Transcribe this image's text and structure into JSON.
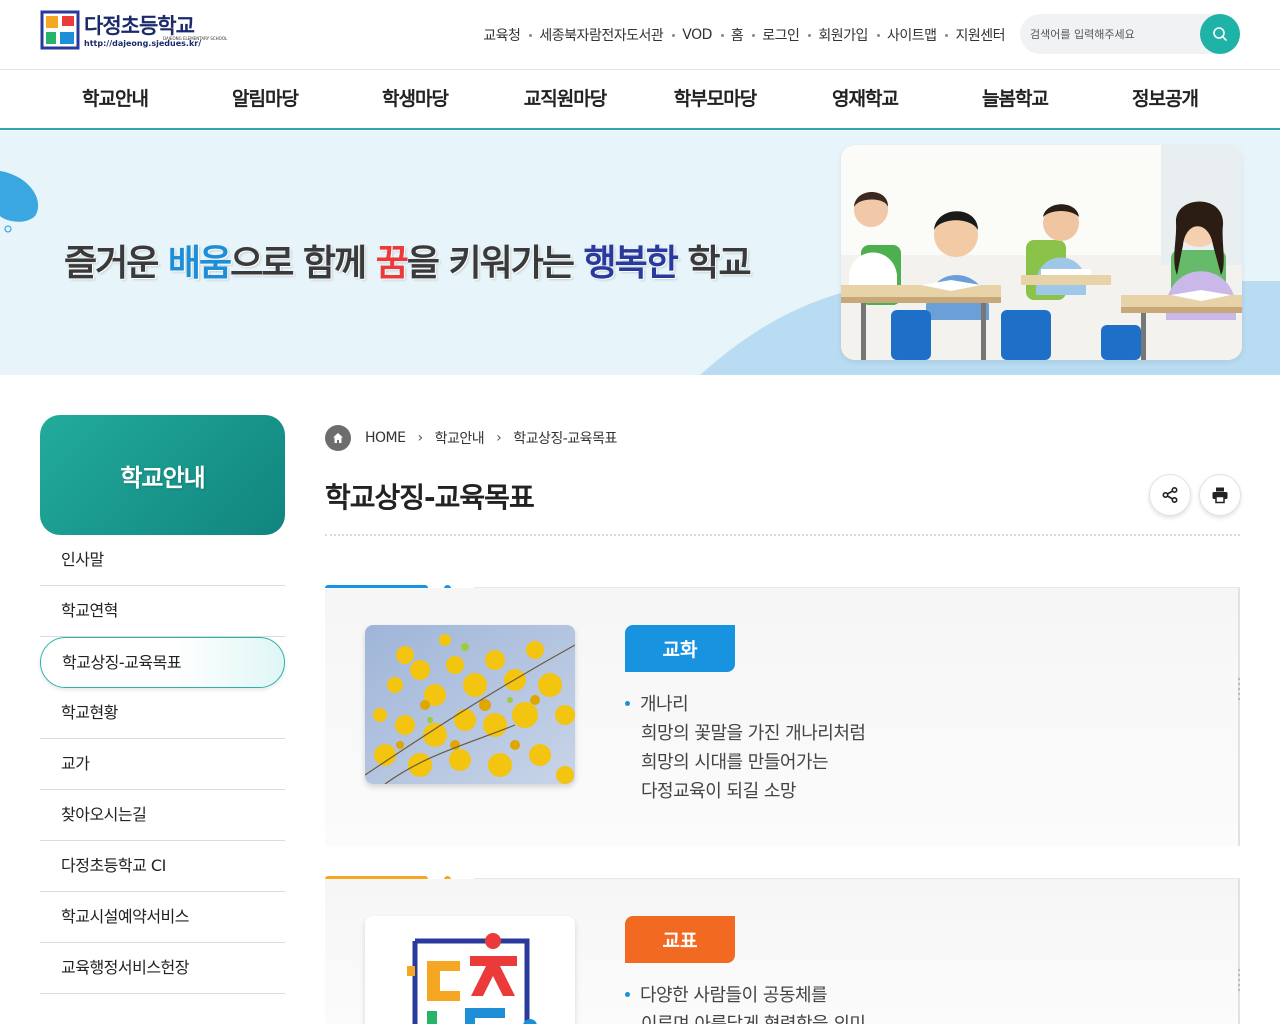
{
  "header": {
    "logo_name": "다정초등학교",
    "logo_en": "DAJEONG ELEMENTARY SCHOOL",
    "logo_url": "http://dajeong.sjedues.kr/",
    "util_links": [
      "교육청",
      "세종북자람전자도서관",
      "VOD",
      "홈",
      "로그인",
      "회원가입",
      "사이트맵",
      "지원센터"
    ],
    "search_placeholder": "검색어를 입력해주세요"
  },
  "gnb": [
    "학교안내",
    "알림마당",
    "학생마당",
    "교직원마당",
    "학부모마당",
    "영재학교",
    "늘봄학교",
    "정보공개"
  ],
  "visual": {
    "slogan_parts": [
      "즐거운 ",
      "배움",
      "으로 함께 ",
      "꿈",
      "을 키워가는 ",
      "행복한",
      " 학교"
    ]
  },
  "lnb": {
    "title": "학교안내",
    "items": [
      "인사말",
      "학교연혁",
      "학교상징-교육목표",
      "학교현황",
      "교가",
      "찾아오시는길",
      "다정초등학교 CI",
      "학교시설예약서비스",
      "교육행정서비스헌장"
    ],
    "active_index": 2
  },
  "breadcrumb": [
    "HOME",
    "학교안내",
    "학교상징-교육목표"
  ],
  "page_title": "학교상징-교육목표",
  "sections": [
    {
      "badge": "교화",
      "color": "#1793e0",
      "bar_color": "#1793e0",
      "lines": [
        "개나리",
        "희망의 꽃말을 가진 개나리처럼",
        "희망의 시대를 만들어가는",
        "다정교육이 되길 소망"
      ]
    },
    {
      "badge": "교표",
      "color": "#f26a22",
      "bar_color": "#f5a623",
      "lines": [
        "다양한 사람들이 공동체를",
        "이루며 아름답게 협력함을 의미"
      ]
    }
  ],
  "colors": {
    "teal": "#1fb2a6",
    "gnb_border": "#2ba7b0",
    "blue": "#1793e0",
    "orange": "#f26a22"
  }
}
